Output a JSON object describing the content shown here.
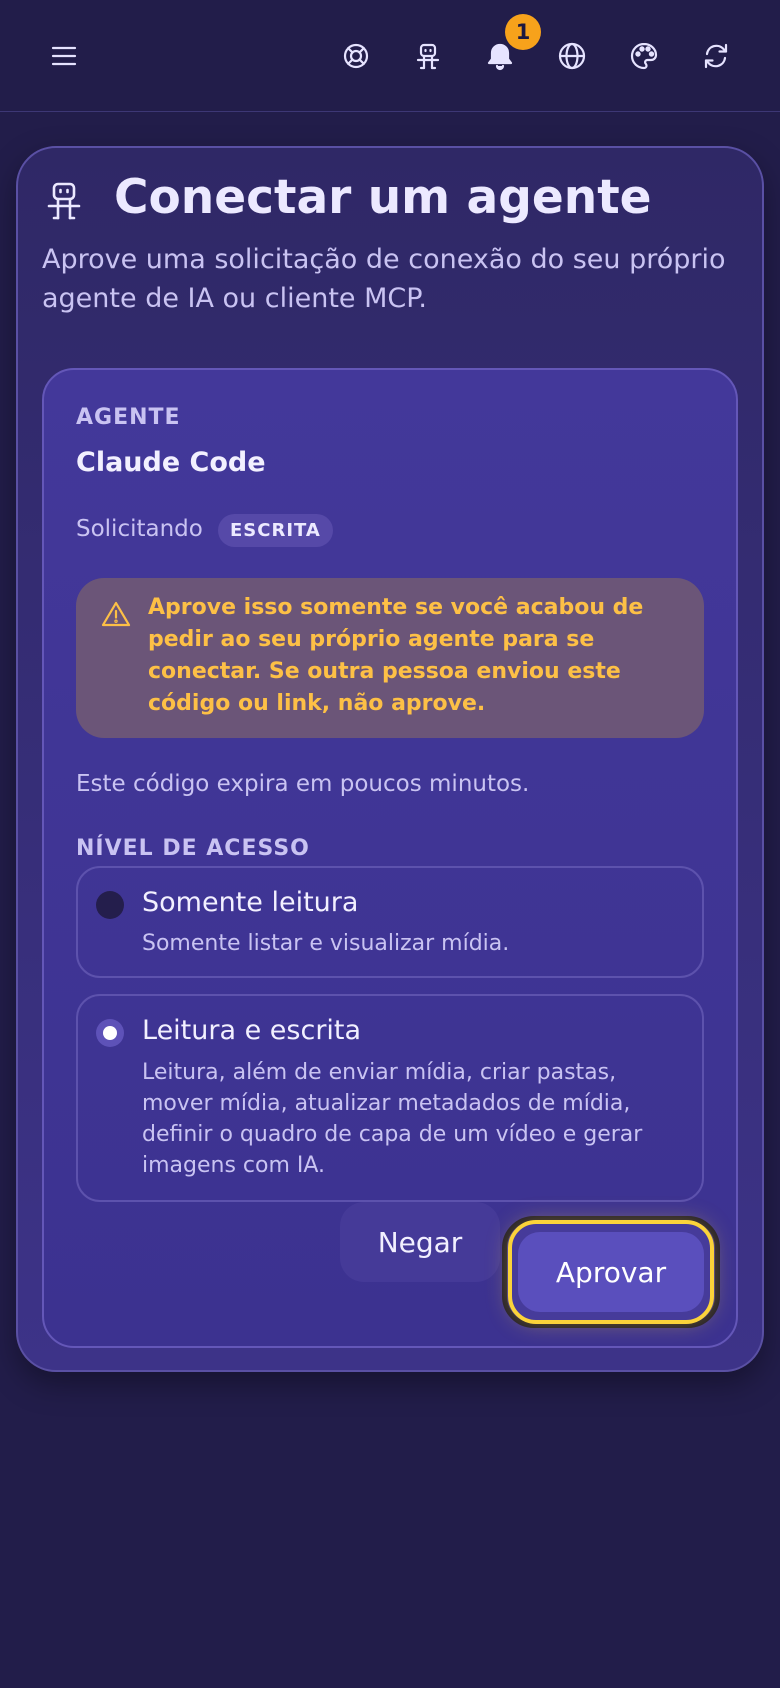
{
  "header": {
    "notification_count": "1",
    "icons": [
      "menu-icon",
      "lifebuoy-icon",
      "robot-icon",
      "bell-icon",
      "globe-icon",
      "palette-icon",
      "refresh-icon"
    ]
  },
  "card": {
    "title": "Conectar um agente",
    "subtitle": "Aprove uma solicitação de conexão do seu próprio agente de IA ou cliente MCP.",
    "agent_label": "AGENTE",
    "agent_name": "Claude Code",
    "requesting_label": "Solicitando",
    "requesting_scope": "ESCRITA",
    "warning": "Aprove isso somente se você acabou de pedir ao seu próprio agente para se conectar. Se outra pessoa enviou este código ou link, não aprove.",
    "expiry_note": "Este código expira em poucos minutos.",
    "access_label": "NÍVEL DE ACESSO",
    "options": [
      {
        "title": "Somente leitura",
        "description": "Somente listar e visualizar mídia.",
        "selected": false
      },
      {
        "title": "Leitura e escrita",
        "description": "Leitura, além de enviar mídia, criar pastas, mover mídia, atualizar metadados de mídia, definir o quadro de capa de um vídeo e gerar imagens com IA.",
        "selected": true
      }
    ],
    "deny_label": "Negar",
    "approve_label": "Aprovar"
  },
  "colors": {
    "background": "#221d4a",
    "warning_text": "#fdc046",
    "focus_ring": "#fbd33a",
    "badge": "#f7a21b"
  }
}
